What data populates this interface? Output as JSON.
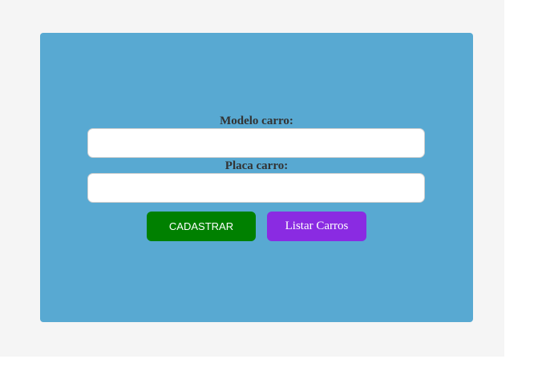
{
  "form": {
    "modelo_label": "Modelo carro:",
    "modelo_value": "",
    "placa_label": "Placa carro:",
    "placa_value": "",
    "cadastrar_label": "CADASTRAR",
    "listar_label": "Listar Carros"
  },
  "colors": {
    "page_background": "#f5f5f5",
    "card_background": "#58a9d2",
    "cadastrar_button": "#008000",
    "listar_button": "#8a2be2",
    "label_text": "#333333"
  }
}
